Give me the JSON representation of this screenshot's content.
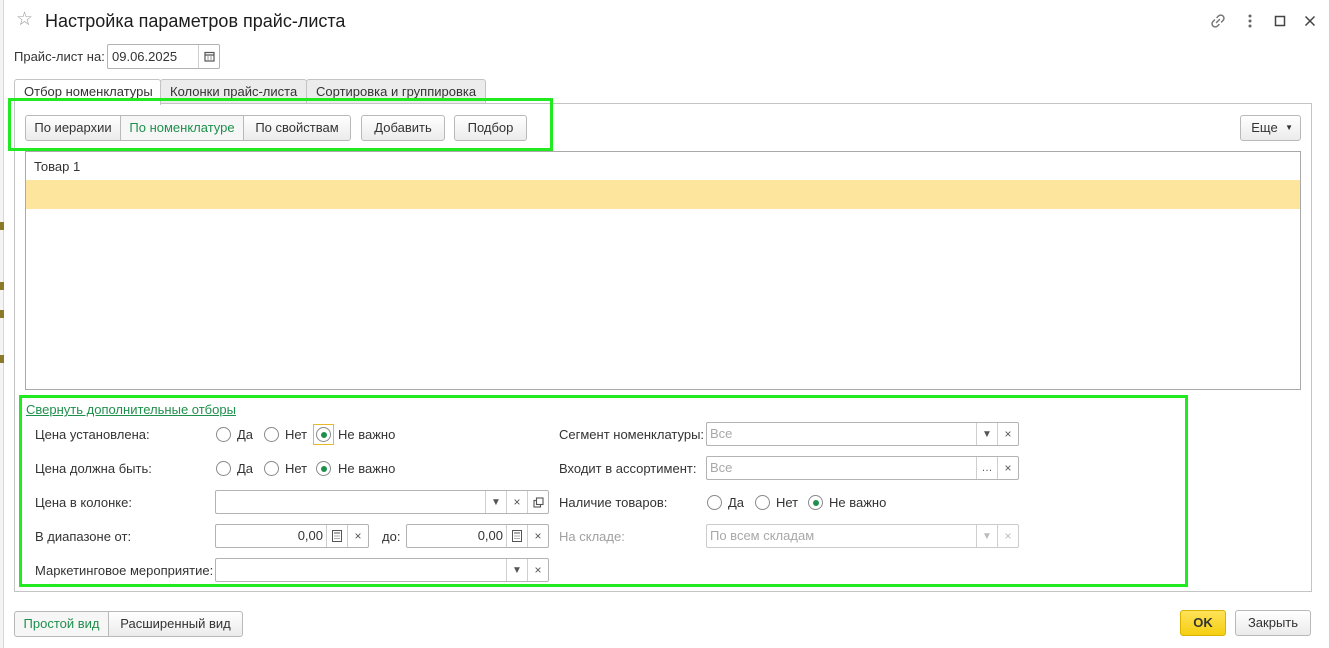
{
  "window": {
    "title": "Настройка параметров прайс-листа",
    "icons": [
      "star-icon",
      "link-icon",
      "more-icon",
      "maximize-icon",
      "close-icon"
    ]
  },
  "date_row": {
    "label": "Прайс-лист на:",
    "value": "09.06.2025"
  },
  "tabs": [
    {
      "label": "Отбор номенклатуры",
      "active": true
    },
    {
      "label": "Колонки прайс-листа",
      "active": false
    },
    {
      "label": "Сортировка и группировка",
      "active": false
    }
  ],
  "toolbar": {
    "modes": [
      {
        "label": "По иерархии",
        "selected": false
      },
      {
        "label": "По номенклатуре",
        "selected": true
      },
      {
        "label": "По свойствам",
        "selected": false
      }
    ],
    "add_label": "Добавить",
    "pick_label": "Подбор",
    "more_label": "Еще"
  },
  "list": {
    "rows": [
      "Товар 1",
      ""
    ]
  },
  "filters": {
    "collapse_link": "Свернуть дополнительные отборы",
    "price_set": {
      "label": "Цена установлена:",
      "options": [
        "Да",
        "Нет",
        "Не важно"
      ],
      "selected": "Не важно"
    },
    "price_must_be": {
      "label": "Цена должна быть:",
      "options": [
        "Да",
        "Нет",
        "Не важно"
      ],
      "selected": "Не важно"
    },
    "price_column": {
      "label": "Цена в колонке:",
      "value": ""
    },
    "range": {
      "label_from": "В диапазоне от:",
      "from_value": "0,00",
      "label_to": "до:",
      "to_value": "0,00"
    },
    "marketing": {
      "label": "Маркетинговое мероприятие:",
      "value": ""
    },
    "segment": {
      "label": "Сегмент номенклатуры:",
      "placeholder": "Все"
    },
    "assortment": {
      "label": "Входит в ассортимент:",
      "placeholder": "Все"
    },
    "stock": {
      "label": "Наличие товаров:",
      "options": [
        "Да",
        "Нет",
        "Не важно"
      ],
      "selected": "Не важно"
    },
    "warehouse": {
      "label": "На складе:",
      "placeholder": "По всем складам"
    }
  },
  "footer": {
    "simple_view": "Простой вид",
    "extended_view": "Расширенный вид",
    "ok_label": "OK",
    "close_label": "Закрыть"
  },
  "colors": {
    "accent_green": "#1f8f4c",
    "selection_row": "#fde59d",
    "highlight_frame": "#21ea21",
    "ok_button": "#f5cf10"
  }
}
